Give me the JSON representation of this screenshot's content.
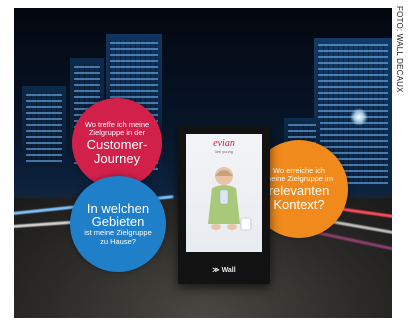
{
  "credit": "FOTO: WALL DECAUX",
  "bubbles": {
    "customer_journey": {
      "line1": "Wo treffe ich meine",
      "line2": "Zielgruppe in der",
      "big1": "Customer-",
      "big2": "Journey",
      "color": "#d1204a"
    },
    "context": {
      "line1": "Wo erreiche ich",
      "line2": "meine Zielgruppe im",
      "big1": "relevanten",
      "big2": "Kontext?",
      "color": "#f08a1c"
    },
    "areas": {
      "big1": "In welchen",
      "big2": "Gebieten",
      "line1": "ist meine Zielgruppe",
      "line2": "zu Hause?",
      "color": "#1f7fc8"
    }
  },
  "kiosk": {
    "brand": "evian",
    "tagline": "live young",
    "label": "Wall"
  }
}
